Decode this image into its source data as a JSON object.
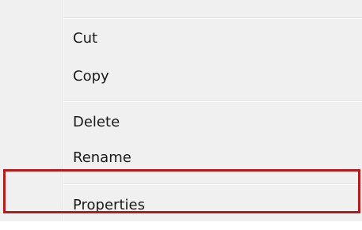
{
  "context_menu": {
    "items": [
      {
        "label": "Cut"
      },
      {
        "label": "Copy"
      },
      {
        "label": "Delete"
      },
      {
        "label": "Rename"
      },
      {
        "label": "Properties"
      }
    ]
  },
  "colors": {
    "menu_background": "#f0f0f0",
    "separator": "#e2e3e3",
    "highlight_box": "#b71c1c"
  }
}
